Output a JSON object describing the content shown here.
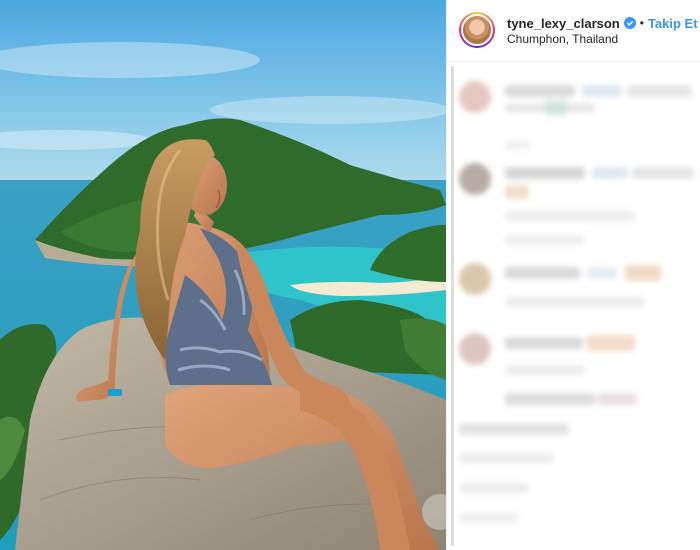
{
  "post": {
    "username": "tyne_lexy_clarson",
    "separator": "•",
    "follow_label": "Takip Et",
    "location": "Chumphon, Thailand"
  },
  "colors": {
    "link_blue": "#3897f0",
    "verified_blue": "#3897f0",
    "text_dark": "#262626",
    "divider": "#efefef"
  },
  "icons": {
    "verified": "verified-badge-icon"
  }
}
